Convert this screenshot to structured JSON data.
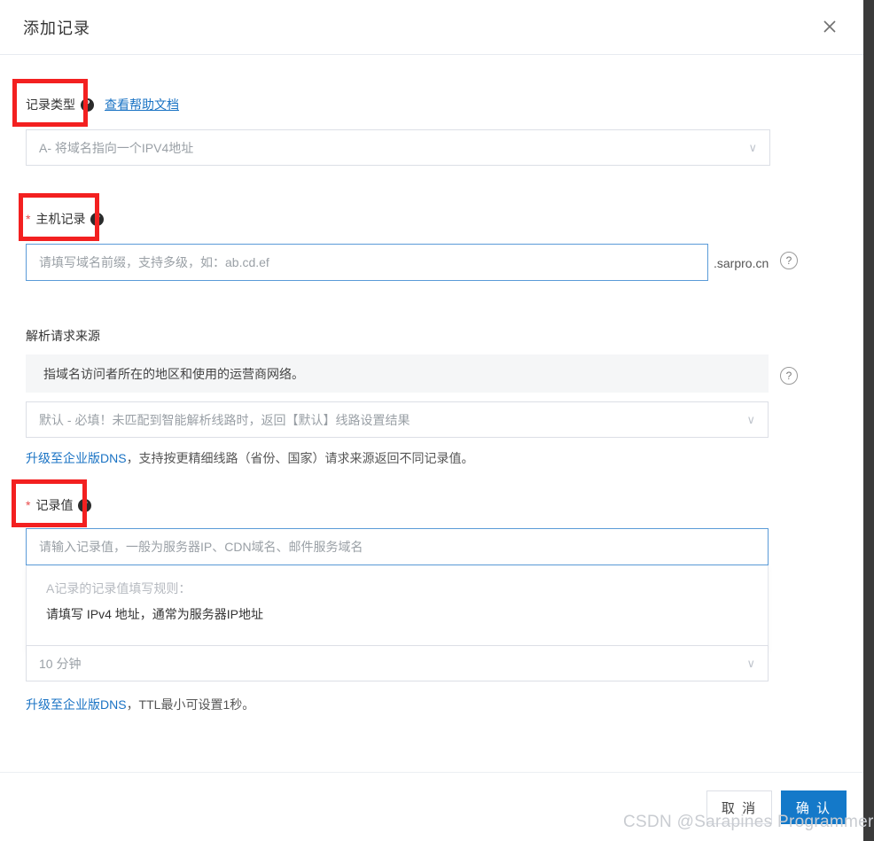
{
  "dialog": {
    "title": "添加记录",
    "close_icon": "close-icon"
  },
  "record_type": {
    "label": "记录类型",
    "help_icon": "?",
    "help_link": "查看帮助文档",
    "value": "A- 将域名指向一个IPV4地址",
    "chevron": "∨"
  },
  "host_record": {
    "required_mark": "*",
    "label": "主机记录",
    "help_icon": "?",
    "placeholder": "请填写域名前缀，支持多级，如：ab.cd.ef",
    "value": "",
    "domain_suffix": ".sarpro.cn",
    "suffix_help_icon": "?"
  },
  "request_source": {
    "label": "解析请求来源",
    "tooltip_text": "指域名访问者所在的地区和使用的运营商网络。",
    "tooltip_help_icon": "?",
    "value": "默认 - 必填！未匹配到智能解析线路时，返回【默认】线路设置结果",
    "chevron": "∨",
    "upgrade_link": "升级至企业版DNS",
    "upgrade_note": "，支持按更精细线路（省份、国家）请求来源返回不同记录值。"
  },
  "record_value": {
    "required_mark": "*",
    "label": "记录值",
    "help_icon": "?",
    "placeholder": "请输入记录值，一般为服务器IP、CDN域名、邮件服务域名",
    "value": "",
    "rules_title": "A记录的记录值填写规则：",
    "rules_text": "请填写 IPv4 地址，通常为服务器IP地址"
  },
  "ttl": {
    "value": "10 分钟",
    "chevron": "∨",
    "upgrade_link": "升级至企业版DNS",
    "upgrade_note": "，TTL最小可设置1秒。"
  },
  "footer": {
    "cancel_label": "取 消",
    "confirm_label": "确 认"
  },
  "watermark": {
    "text": "CSDN @Sarapines Programmer"
  },
  "colors": {
    "accent": "#1479c9",
    "link": "#1a73c4",
    "annotation": "#f32020",
    "required": "#e94b4b",
    "page_bg": "#3a3a3a"
  }
}
